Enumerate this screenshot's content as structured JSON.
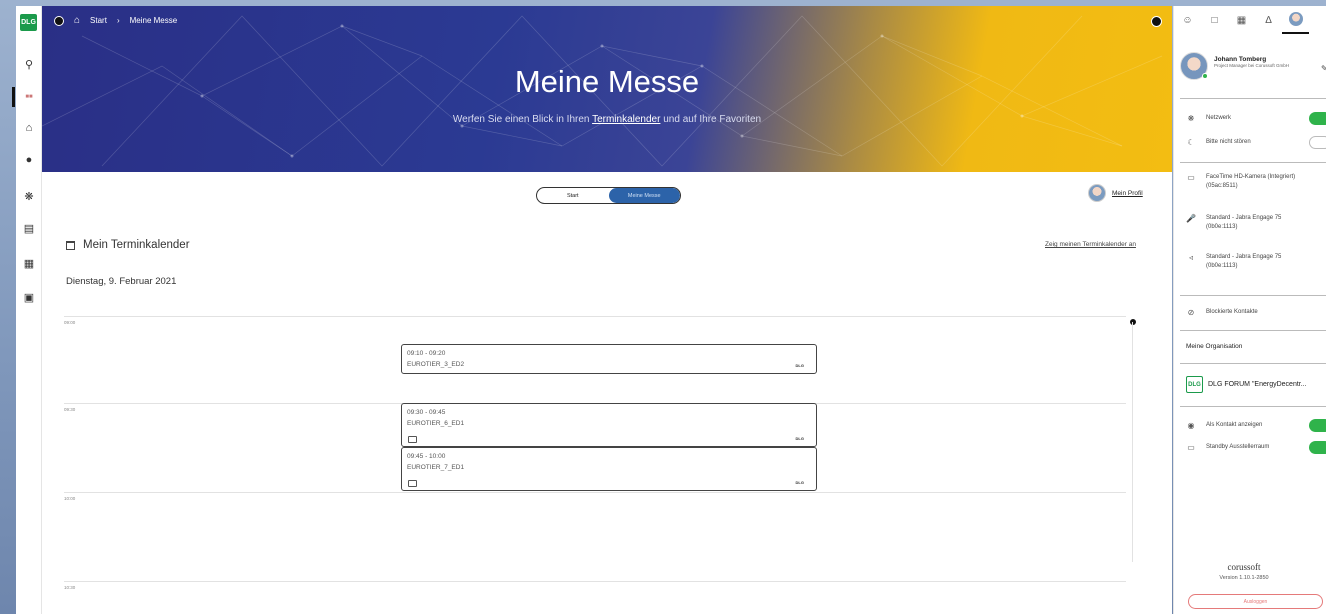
{
  "sidebar": {
    "logo": "DLG",
    "icons": [
      "search-icon",
      "expo-icon",
      "home-icon",
      "location-icon",
      "network-icon",
      "document-icon",
      "shop-icon",
      "gift-icon"
    ]
  },
  "hero": {
    "breadcrumb_home": "Start",
    "breadcrumb_sep": "›",
    "breadcrumb_current": "Meine Messe",
    "title": "Meine Messe",
    "subtitle_before": "Werfen Sie einen Blick in Ihren",
    "subtitle_link": "Terminkalender",
    "subtitle_after": "und auf Ihre Favoriten"
  },
  "toggle": {
    "left": "Start",
    "right": "Meine Messe",
    "selected": "Meine Messe"
  },
  "profile_link": "Mein Profil",
  "calendar": {
    "heading": "Mein Terminkalender",
    "show_all_link": "Zeig meinen Terminkalender an",
    "date": "Dienstag, 9. Februar 2021",
    "time_slots": [
      "09:00",
      "09:30",
      "10:00",
      "10:30"
    ],
    "appointments": [
      {
        "time": "09:10 - 09:20",
        "name": "EUROTIER_3_ED2",
        "logo": "DLG"
      },
      {
        "time": "09:30 - 09:45",
        "name": "EUROTIER_6_ED1",
        "logo": "DLG"
      },
      {
        "time": "09:45 - 10:00",
        "name": "EUROTIER_7_ED1",
        "logo": "DLG"
      }
    ]
  },
  "right_panel": {
    "tabs": [
      "person-icon",
      "chat-icon",
      "calendar-icon",
      "bell-icon",
      "avatar"
    ],
    "user": {
      "name": "Johann Tomberg",
      "role": "Project Manager bei Corussoft GmbH"
    },
    "settings": [
      {
        "label": "Netzwerk",
        "toggle": true
      },
      {
        "label": "Bitte nicht stören",
        "toggle": false
      }
    ],
    "devices": [
      {
        "label": "FaceTime HD-Kamera (Integriert) (05ac:8511)"
      },
      {
        "label": "Standard - Jabra Engage 75 (0b0e:1113)"
      },
      {
        "label": "Standard - Jabra Engage 75 (0b0e:1113)"
      }
    ],
    "blocked": "Blockierte Kontakte",
    "org_heading": "Meine Organisation",
    "org_name": "DLG FORUM \"EnergyDecentr...",
    "org_logo": "DLG",
    "org_settings": [
      {
        "label": "Als Kontakt anzeigen",
        "toggle": true
      },
      {
        "label": "Standby Ausstellerraum",
        "toggle": true
      }
    ],
    "brand": "corussoft",
    "version": "Version 1.10.1-2850",
    "logout": "Ausloggen"
  },
  "colors": {
    "hero_blue": "#2a2f86",
    "hero_yellow": "#f3bd12",
    "toggle_on": "#2fb34b",
    "segment_active": "#2c63a9",
    "logout": "#e57a7a"
  }
}
